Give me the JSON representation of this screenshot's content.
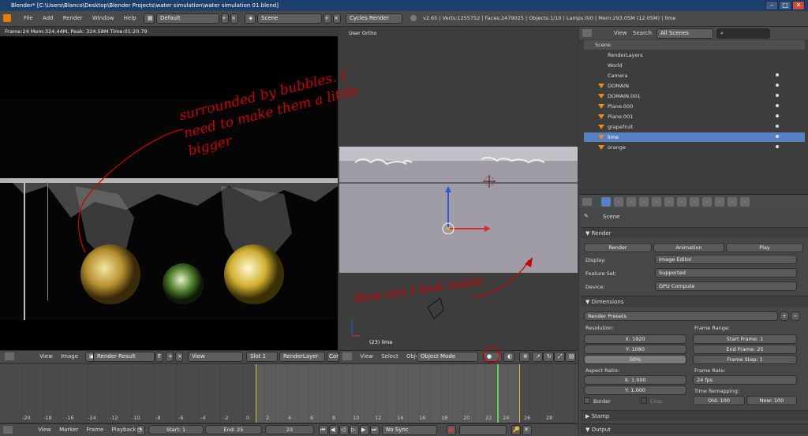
{
  "window": {
    "title": "Blender* [C:\\Users\\Blanco\\Desktop\\Blender Projects\\water simulation\\water simulation 01.blend]"
  },
  "info_header": {
    "menu": [
      "File",
      "Add",
      "Render",
      "Window",
      "Help"
    ],
    "layout": "Default",
    "scene": "Scene",
    "engine": "Cycles Render",
    "stats": "v2.65 | Verts:1255752 | Faces:2479025 | Objects:1/10 | Lamps:0/0 | Mem:293.05M (12.05M) | lime"
  },
  "render_view": {
    "status": "Frame:24 Mem:324.44M, Peak: 324.58M Time:01:20.79",
    "header": {
      "menu": [
        "View",
        "Image"
      ],
      "image": "Render Result",
      "f_label": "F",
      "view": "View",
      "slot": "Slot 1",
      "layer": "RenderLayer",
      "combined": "Cor"
    }
  },
  "viewport": {
    "label": "User Ortho",
    "object_label": "(23) lime",
    "header": {
      "menu": [
        "View",
        "Select",
        "Object"
      ],
      "mode": "Object Mode"
    }
  },
  "outliner": {
    "header": {
      "view": "View",
      "search": "Search",
      "filter": "All Scenes"
    },
    "items": [
      "Scene",
      "RenderLayers",
      "World",
      "Camera",
      "DOMAIN",
      "DOMAIN.001",
      "Plane.000",
      "Plane.001",
      "grapefruit",
      "lime",
      "orange"
    ]
  },
  "properties": {
    "context": "Scene",
    "render": {
      "title": "Render",
      "render_btn": "Render",
      "animation_btn": "Animation",
      "play_btn": "Play",
      "display_label": "Display:",
      "display_value": "Image Editor",
      "feature_label": "Feature Set:",
      "feature_value": "Supported",
      "device_label": "Device:",
      "device_value": "GPU Compute"
    },
    "dimensions": {
      "title": "Dimensions",
      "presets": "Render Presets",
      "resolution_label": "Resolution:",
      "x": "X: 1920",
      "y": "Y: 1080",
      "percent": "50%",
      "frame_range_label": "Frame Range:",
      "start": "Start Frame: 1",
      "end": "End Frame: 25",
      "step": "Frame Step: 1",
      "aspect_label": "Aspect Ratio:",
      "ax": "X: 1.000",
      "ay": "Y: 1.000",
      "frame_rate_label": "Frame Rate:",
      "fps": "24 fps",
      "remap_label": "Time Remapping:",
      "old": "Old: 100",
      "new": "New: 100",
      "border": "Border",
      "crop": "Crop"
    },
    "stamp": "Stamp",
    "output": "Output"
  },
  "timeline": {
    "ticks": [
      "-20",
      "-18",
      "-16",
      "-14",
      "-12",
      "-10",
      "-8",
      "-6",
      "-4",
      "-2",
      "0",
      "2",
      "4",
      "6",
      "8",
      "10",
      "12",
      "14",
      "16",
      "18",
      "20",
      "22",
      "24",
      "26",
      "28"
    ],
    "menu": [
      "View",
      "Marker",
      "Frame",
      "Playback"
    ],
    "start": "Start: 1",
    "end": "End: 25",
    "current": "23",
    "sync": "No Sync"
  },
  "annotations": {
    "top": "surrounded by bubbles. I need to make them a little bigger",
    "bottom": "How can I look inside"
  },
  "colors": {
    "annotation": "#cc0000",
    "titlebar": "#1c3f6b",
    "selection": "#5680c2"
  }
}
